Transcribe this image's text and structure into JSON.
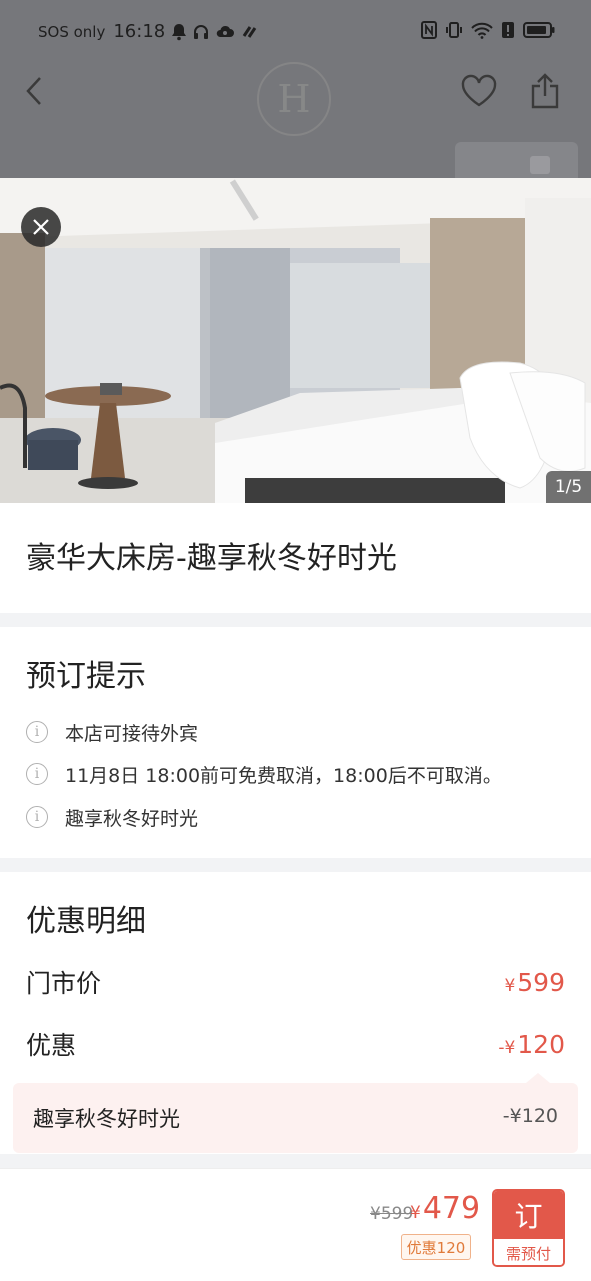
{
  "status_bar": {
    "carrier": "SOS only",
    "time": "16:18"
  },
  "photo": {
    "counter": "1/5"
  },
  "room": {
    "title": "豪华大床房-趣享秋冬好时光"
  },
  "booking_notice": {
    "title": "预订提示",
    "items": [
      "本店可接待外宾",
      "11月8日 18:00前可免费取消，18:00后不可取消。",
      "趣享秋冬好时光"
    ],
    "icon_glyph": "i"
  },
  "discount_details": {
    "title": "优惠明细",
    "rows": [
      {
        "label": "门市价",
        "currency": "¥",
        "amount": "599"
      },
      {
        "label": "优惠",
        "currency": "-¥",
        "amount": "120"
      }
    ],
    "breakdown": {
      "name": "趣享秋冬好时光",
      "amount": "-¥120"
    }
  },
  "bottom_bar": {
    "original_price": "¥599",
    "currency": "¥",
    "final_price": "479",
    "saving_badge": "优惠120",
    "book_button": {
      "label": "订",
      "sublabel": "需预付"
    }
  },
  "hotel_logo_letter": "H",
  "colors": {
    "accent": "#e2584a",
    "badge": "#e07a3a",
    "overlay": "#76777b"
  }
}
